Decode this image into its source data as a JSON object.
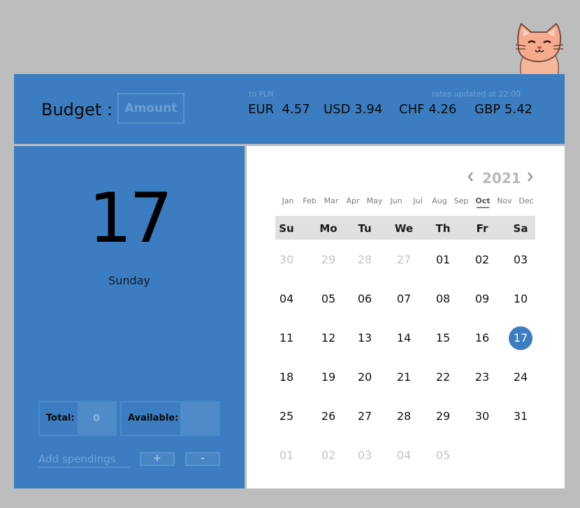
{
  "header": {
    "budget_label": "Budget :",
    "amount_placeholder": "Amount",
    "to_pln": "to PLN",
    "rates_updated": "rates updated at  22:00",
    "rates": [
      {
        "code": "EUR",
        "value": "4.57"
      },
      {
        "code": "USD",
        "value": "3.94"
      },
      {
        "code": "CHF",
        "value": "4.26"
      },
      {
        "code": "GBP",
        "value": "5.42"
      }
    ]
  },
  "left": {
    "day_number": "17",
    "weekday": "Sunday",
    "total_label": "Total:",
    "total_value": "0",
    "available_label": "Available:",
    "available_value": "",
    "spend_placeholder": "Add spendings",
    "plus_label": "+",
    "minus_label": "-"
  },
  "calendar": {
    "year": "2021",
    "months": [
      "Jan",
      "Feb",
      "Mar",
      "Apr",
      "May",
      "Jun",
      "Jul",
      "Aug",
      "Sep",
      "Oct",
      "Nov",
      "Dec"
    ],
    "active_month_index": 9,
    "weekdays": [
      "Su",
      "Mo",
      "Tu",
      "We",
      "Th",
      "Fr",
      "Sa"
    ],
    "selected_day": "17",
    "weeks": [
      [
        {
          "d": "30",
          "m": true
        },
        {
          "d": "29",
          "m": true
        },
        {
          "d": "28",
          "m": true
        },
        {
          "d": "27",
          "m": true
        },
        {
          "d": "01"
        },
        {
          "d": "02"
        },
        {
          "d": "03"
        }
      ],
      [
        {
          "d": "04"
        },
        {
          "d": "05"
        },
        {
          "d": "06"
        },
        {
          "d": "07"
        },
        {
          "d": "08"
        },
        {
          "d": "09"
        },
        {
          "d": "10"
        }
      ],
      [
        {
          "d": "11"
        },
        {
          "d": "12"
        },
        {
          "d": "13"
        },
        {
          "d": "14"
        },
        {
          "d": "15"
        },
        {
          "d": "16"
        },
        {
          "d": "17",
          "sel": true
        }
      ],
      [
        {
          "d": "18"
        },
        {
          "d": "19"
        },
        {
          "d": "20"
        },
        {
          "d": "21"
        },
        {
          "d": "22"
        },
        {
          "d": "23"
        },
        {
          "d": "24"
        }
      ],
      [
        {
          "d": "25"
        },
        {
          "d": "26"
        },
        {
          "d": "27"
        },
        {
          "d": "28"
        },
        {
          "d": "29"
        },
        {
          "d": "30"
        },
        {
          "d": "31"
        }
      ],
      [
        {
          "d": "01",
          "m": true
        },
        {
          "d": "02",
          "m": true
        },
        {
          "d": "03",
          "m": true
        },
        {
          "d": "04",
          "m": true
        },
        {
          "d": "05",
          "m": true
        }
      ]
    ]
  },
  "colors": {
    "primary": "#3b7dc0",
    "background": "#bdbdbd",
    "selected_day": "#3b7dc0",
    "muted_text": "#c4c4c4"
  },
  "icons": {
    "mascot": "cat-mascot-icon",
    "prev": "chevron-left-icon",
    "next": "chevron-right-icon"
  }
}
